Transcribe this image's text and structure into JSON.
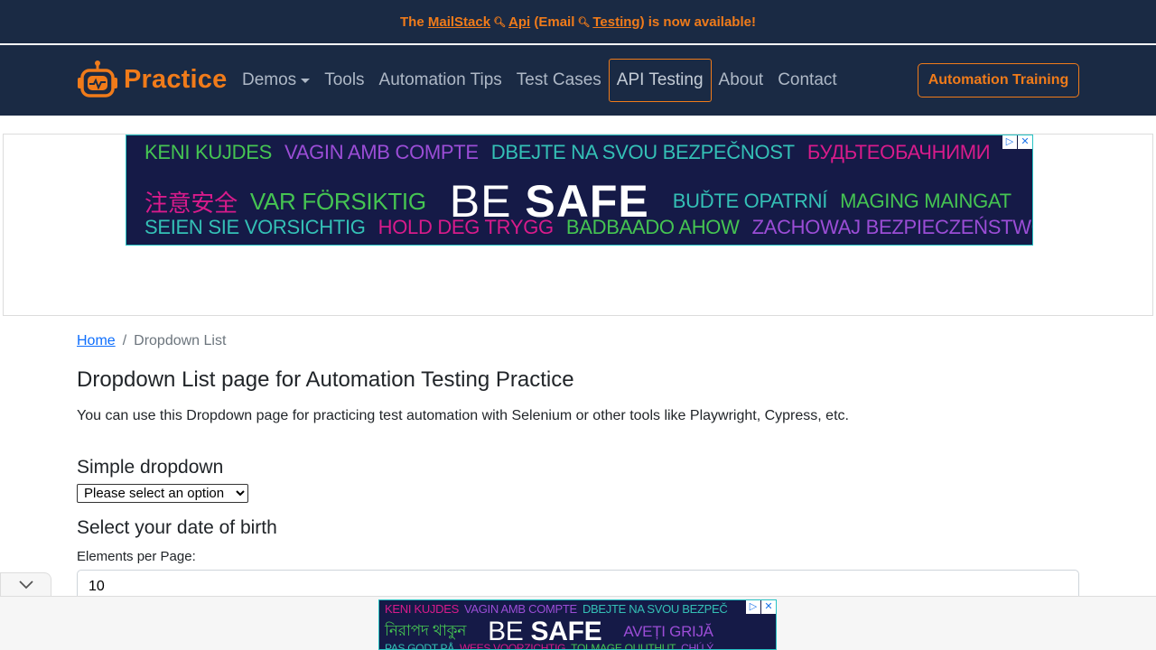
{
  "announcement": {
    "prefix": "The",
    "link1": "MailStack",
    "middle1": "Api",
    "middle2": "(Email",
    "link2": "Testing)",
    "suffix": "is now available!"
  },
  "navbar": {
    "brand": "Practice",
    "links": [
      "Demos",
      "Tools",
      "Automation Tips",
      "Test Cases",
      "API Testing",
      "About",
      "Contact"
    ],
    "active": "API Testing",
    "cta": "Automation Training"
  },
  "ad_top": {
    "row1": [
      "KENI KUJDES",
      "VAGIN AMB COMPTE",
      "DBEJTE NA SVOU BEZPEČNOST",
      "БУДЬТЕОБАЧНИМИ"
    ],
    "row2_left": [
      "注意安全",
      "VAR FÖRSIKTIG"
    ],
    "big_thin": "BE",
    "big_bold": "SAFE",
    "row2_right": [
      "BUĎTE OPATRNÍ",
      "MAGING MAINGAT"
    ],
    "row3": [
      "SEIEN SIE VORSICHTIG",
      "HOLD DEG TRYGG",
      "BADBAADO AHOW",
      "ZACHOWAJ BEZPIECZEŃSTWO"
    ]
  },
  "ad_bottom": {
    "row1": [
      "KENI KUJDES",
      "VAGIN AMB COMPTE",
      "DBEJTE NA SVOU BEZPEČ"
    ],
    "row2_left": "নিরাপদ থাকুন",
    "big_thin": "BE",
    "big_bold": "SAFE",
    "row2_right": "AVEȚI GRIJĂ",
    "row3": [
      "PAS GODT PÅ",
      "WEES VOORZICHTIG",
      "TOLMAGE OUUTHUT",
      "CHÚ Ý"
    ]
  },
  "breadcrumb": {
    "home": "Home",
    "current": "Dropdown List",
    "separator": "/"
  },
  "page": {
    "title": "Dropdown List page for Automation Testing Practice",
    "intro": "You can use this Dropdown page for practicing test automation with Selenium or other tools like Playwright, Cypress, etc."
  },
  "simple_dropdown": {
    "heading": "Simple dropdown",
    "selected": "Please select an option"
  },
  "dob": {
    "heading": "Select your date of birth",
    "epp_label": "Elements per Page:",
    "epp_value": "10"
  },
  "colors": {
    "navy": "#1a2a44",
    "accent": "#f07b1a",
    "link": "#0d6efd"
  }
}
